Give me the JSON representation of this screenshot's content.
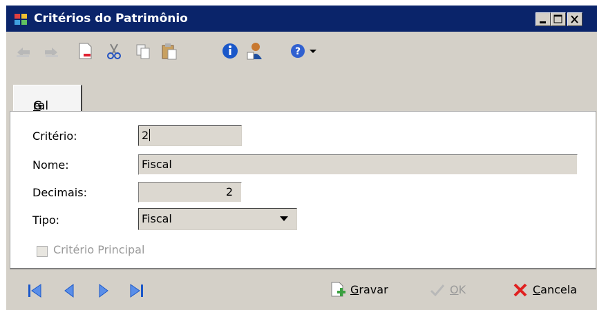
{
  "window": {
    "title": "Critérios do Patrimônio",
    "controls": [
      "minimize",
      "maximize",
      "close"
    ]
  },
  "toolbar": {
    "icons": [
      "back-icon",
      "forward-icon",
      "new-document-icon",
      "cut-icon",
      "copy-icon",
      "paste-icon",
      "info-icon",
      "user-icon",
      "help-icon",
      "dropdown-arrow-icon"
    ]
  },
  "tabs": [
    {
      "label_pre": "G",
      "label_u": "e",
      "label_post": "ral",
      "selected": true
    }
  ],
  "form": {
    "criterio": {
      "label": "Critério:",
      "value": "2"
    },
    "nome": {
      "label": "Nome:",
      "value": "Fiscal"
    },
    "decimais": {
      "label": "Decimais:",
      "value": "2"
    },
    "tipo": {
      "label": "Tipo:",
      "value": "Fiscal"
    },
    "principal": {
      "label": "Critério Principal",
      "checked": false,
      "enabled": false
    }
  },
  "footer": {
    "gravar": {
      "u": "G",
      "rest": "ravar"
    },
    "ok": {
      "u": "O",
      "rest": "K",
      "enabled": false
    },
    "cancela": {
      "u": "C",
      "rest": "ancela"
    }
  },
  "colors": {
    "titlebar": "#0a246a",
    "window": "#d4d0c8",
    "nav_blue": "#1a57c9",
    "cancel_red": "#e02020",
    "save_green": "#3aa040"
  }
}
